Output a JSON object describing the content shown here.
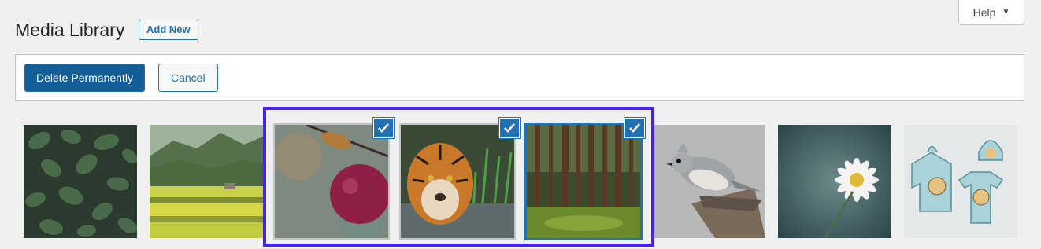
{
  "header": {
    "title": "Media Library",
    "add_new_label": "Add New",
    "help_label": "Help"
  },
  "toolbar": {
    "delete_label": "Delete Permanently",
    "cancel_label": "Cancel"
  },
  "attachments": [
    {
      "subject": "green leaves",
      "selected": false
    },
    {
      "subject": "green fields and hills",
      "selected": false
    },
    {
      "subject": "apple on branch",
      "selected": true
    },
    {
      "subject": "tiger in water",
      "selected": true
    },
    {
      "subject": "pine forest",
      "selected": true
    },
    {
      "subject": "titmouse bird on stump",
      "selected": false
    },
    {
      "subject": "white daisy",
      "selected": false
    },
    {
      "subject": "hoodie, beanie and t-shirt",
      "selected": false
    }
  ],
  "colors": {
    "accent": "#2271b1",
    "highlight": "#4722f0",
    "background": "#f0f0f1"
  }
}
